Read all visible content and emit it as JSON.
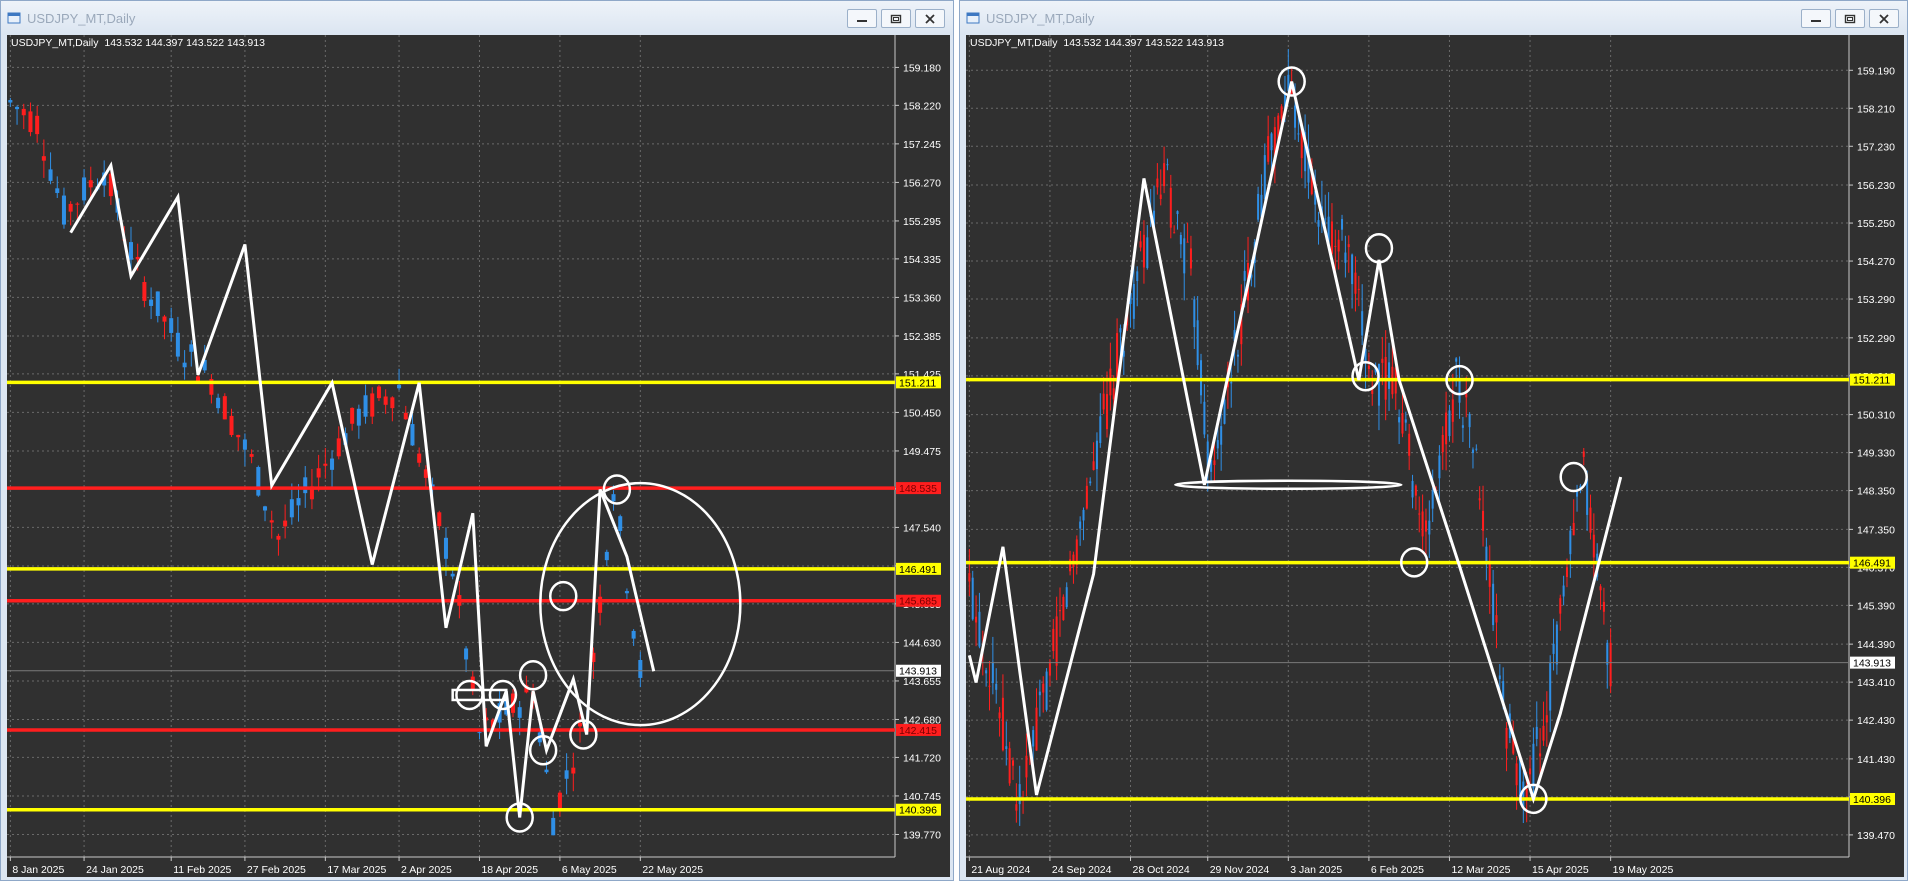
{
  "windows": [
    {
      "title": "USDJPY_MT,Daily",
      "info": "USDJPY_MT,Daily  143.532 144.397 143.522 143.913",
      "chart_data": {
        "type": "line",
        "symbol": "USDJPY_MT",
        "timeframe": "Daily",
        "ohlc": {
          "open": 143.532,
          "high": 144.397,
          "low": 143.522,
          "close": 143.913
        },
        "last_price": "143.913",
        "ylim": [
          139.2,
          160.0
        ],
        "y_ticks": [
          "159.180",
          "158.220",
          "157.245",
          "156.270",
          "155.295",
          "154.335",
          "153.360",
          "152.385",
          "151.425",
          "150.450",
          "149.475",
          "148.515",
          "147.540",
          "146.565",
          "145.605",
          "144.630",
          "143.655",
          "142.680",
          "141.720",
          "140.745",
          "139.770"
        ],
        "x_ticks": [
          "8 Jan 2025",
          "24 Jan 2025",
          "11 Feb 2025",
          "27 Feb 2025",
          "17 Mar 2025",
          "2 Apr 2025",
          "18 Apr 2025",
          "6 May 2025",
          "22 May 2025"
        ],
        "x_ticks_pos": [
          0,
          11,
          24,
          35,
          47,
          58,
          70,
          82,
          94
        ],
        "x_range": [
          -0.5,
          132
        ],
        "horizontal_lines": [
          {
            "price": 151.211,
            "label": "151.211",
            "color": "#ffff00"
          },
          {
            "price": 148.535,
            "label": "148.535",
            "color": "#ff1e1e"
          },
          {
            "price": 146.491,
            "label": "146.491",
            "color": "#ffff00"
          },
          {
            "price": 145.685,
            "label": "145.685",
            "color": "#ff1e1e"
          },
          {
            "price": 142.415,
            "label": "142.415",
            "color": "#ff1e1e"
          },
          {
            "price": 140.396,
            "label": "140.396",
            "color": "#ffff00"
          }
        ],
        "price_path": {
          "x": [
            0,
            4,
            8,
            14,
            19,
            25,
            30,
            36,
            40,
            46,
            52,
            58,
            66,
            70,
            78,
            81,
            86,
            90,
            94
          ],
          "y": [
            158.3,
            157.8,
            155.5,
            156.6,
            154.0,
            152.2,
            151.3,
            149.2,
            147.3,
            148.9,
            150.4,
            151.1,
            146.5,
            142.3,
            143.4,
            140.2,
            142.8,
            148.6,
            143.9
          ]
        },
        "zigzag": {
          "x": [
            9,
            15,
            18,
            25,
            28,
            35,
            39,
            48,
            54,
            61,
            65,
            69,
            71,
            74,
            76,
            78,
            80,
            84,
            86,
            88,
            92,
            96
          ],
          "y": [
            155.0,
            156.7,
            153.9,
            155.9,
            151.4,
            154.7,
            148.6,
            151.2,
            146.6,
            151.2,
            145.0,
            147.9,
            142.0,
            143.4,
            140.2,
            143.4,
            141.9,
            143.7,
            142.3,
            148.5,
            146.8,
            143.9
          ]
        },
        "circles": [
          {
            "x": 68.5,
            "y": 143.3
          },
          {
            "x": 73.5,
            "y": 143.3
          },
          {
            "x": 76,
            "y": 140.2
          },
          {
            "x": 78,
            "y": 143.8
          },
          {
            "x": 79.5,
            "y": 141.9
          },
          {
            "x": 82.5,
            "y": 145.8
          },
          {
            "x": 85.5,
            "y": 142.3
          },
          {
            "x": 90.5,
            "y": 148.5
          }
        ],
        "big_ellipse": {
          "x": 94,
          "y": 145.6
        },
        "bracket": {
          "x1": 66,
          "x2": 74,
          "y": 143.3
        }
      }
    },
    {
      "title": "USDJPY_MT,Daily",
      "info": "USDJPY_MT,Daily  143.532 144.397 143.522 143.913",
      "chart_data": {
        "type": "line",
        "symbol": "USDJPY_MT",
        "timeframe": "Daily",
        "ohlc": {
          "open": 143.532,
          "high": 144.397,
          "low": 143.522,
          "close": 143.913
        },
        "last_price": "143.913",
        "ylim": [
          138.9,
          160.1
        ],
        "y_ticks": [
          "159.190",
          "158.210",
          "157.230",
          "156.230",
          "155.250",
          "154.270",
          "153.290",
          "152.290",
          "151.310",
          "150.310",
          "149.330",
          "148.350",
          "147.350",
          "146.370",
          "145.390",
          "144.390",
          "143.410",
          "142.430",
          "141.430",
          "140.450",
          "139.470"
        ],
        "x_ticks": [
          "21 Aug 2024",
          "24 Sep 2024",
          "28 Oct 2024",
          "29 Nov 2024",
          "3 Jan 2025",
          "6 Feb 2025",
          "12 Mar 2025",
          "15 Apr 2025",
          "19 May 2025"
        ],
        "x_ticks_pos": [
          0,
          24,
          48,
          71,
          95,
          119,
          143,
          167,
          191
        ],
        "x_range": [
          -1,
          262
        ],
        "horizontal_lines": [
          {
            "price": 151.211,
            "label": "151.211",
            "color": "#ffff00"
          },
          {
            "price": 146.491,
            "label": "146.491",
            "color": "#ffff00"
          },
          {
            "price": 140.396,
            "label": "140.396",
            "color": "#ffff00"
          }
        ],
        "price_path": {
          "x": [
            0,
            8,
            15,
            25,
            35,
            45,
            58,
            66,
            72,
            80,
            89,
            96,
            104,
            112,
            120,
            127,
            136,
            145,
            150,
            160,
            166,
            172,
            183,
            191
          ],
          "y": [
            145.9,
            143.2,
            140.2,
            144.1,
            148.3,
            152.1,
            156.4,
            153.9,
            148.5,
            152.3,
            157.0,
            158.8,
            155.3,
            154.6,
            151.2,
            151.2,
            147.0,
            151.3,
            149.7,
            142.3,
            140.4,
            142.8,
            148.8,
            143.9
          ]
        },
        "zigzag": {
          "x": [
            0,
            2,
            10,
            20,
            37,
            52,
            70,
            96,
            116,
            122,
            128,
            146,
            168,
            176,
            194
          ],
          "y": [
            144.1,
            143.4,
            146.9,
            140.5,
            146.2,
            156.4,
            148.5,
            158.9,
            151.2,
            154.3,
            151.2,
            146.4,
            140.4,
            142.6,
            148.7
          ]
        },
        "circles": [
          {
            "x": 96,
            "y": 158.9
          },
          {
            "x": 122,
            "y": 154.6
          },
          {
            "x": 118,
            "y": 151.3
          },
          {
            "x": 146,
            "y": 151.2
          },
          {
            "x": 132.5,
            "y": 146.5
          },
          {
            "x": 168,
            "y": 140.4
          },
          {
            "x": 180,
            "y": 148.7
          }
        ],
        "neck_ellipse": {
          "x": 95,
          "y": 148.5
        }
      }
    }
  ],
  "colors": {
    "chart_bg": "#303030",
    "grid": "#6a6a6a",
    "bull_candle": "#2f8fe6",
    "bear_candle": "#ff1e1e",
    "drawing": "#ffffff",
    "yellow_line": "#ffff00",
    "red_line": "#ff1e1e"
  },
  "icons": [
    "app-window-icon",
    "minimize-icon",
    "maximize-icon",
    "close-icon"
  ]
}
